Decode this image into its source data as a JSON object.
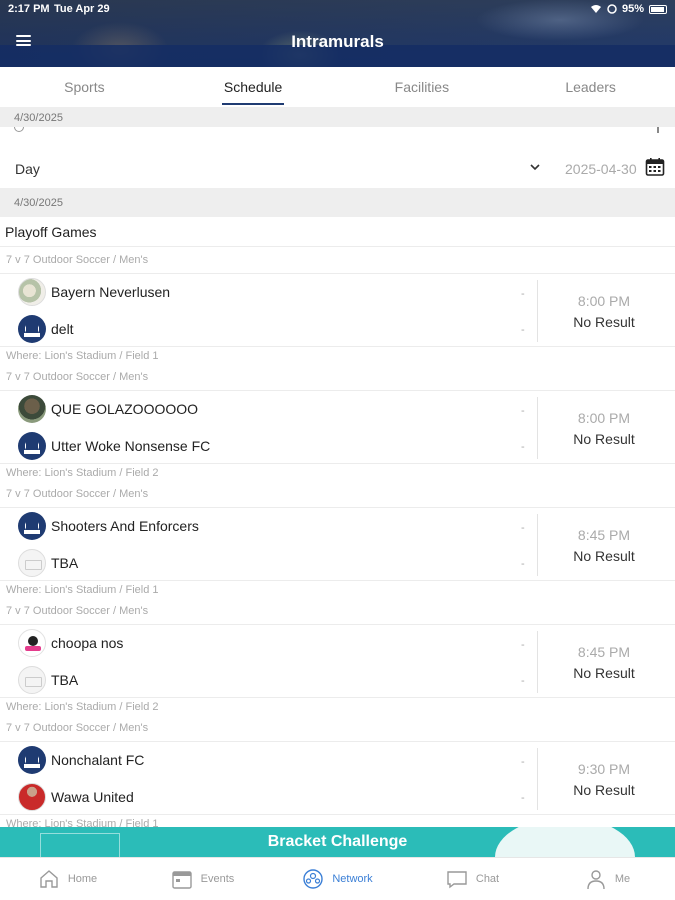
{
  "status_bar": {
    "time": "2:17 PM",
    "date": "Tue Apr 29",
    "battery": "95%"
  },
  "app": {
    "title": "Intramurals"
  },
  "tabs": [
    {
      "label": "Sports",
      "active": false
    },
    {
      "label": "Schedule",
      "active": true
    },
    {
      "label": "Facilities",
      "active": false
    },
    {
      "label": "Leaders",
      "active": false
    }
  ],
  "top_band_date": "4/30/2025",
  "filter": {
    "view": "Day",
    "date": "2025-04-30"
  },
  "schedule_date": "4/30/2025",
  "group_title": "Playoff Games",
  "games": [
    {
      "sport": "7 v 7 Outdoor Soccer / Men's",
      "team1": {
        "name": "Bayern Neverlusen",
        "score": "-"
      },
      "team2": {
        "name": "delt",
        "score": "-"
      },
      "time": "8:00 PM",
      "result": "No Result",
      "where": "Where: Lion's Stadium / Field 1"
    },
    {
      "sport": "7 v 7 Outdoor Soccer / Men's",
      "team1": {
        "name": "QUE GOLAZOOOOOO",
        "score": "-"
      },
      "team2": {
        "name": "Utter Woke Nonsense FC",
        "score": "-"
      },
      "time": "8:00 PM",
      "result": "No Result",
      "where": "Where: Lion's Stadium / Field 2"
    },
    {
      "sport": "7 v 7 Outdoor Soccer / Men's",
      "team1": {
        "name": "Shooters And Enforcers",
        "score": "-"
      },
      "team2": {
        "name": "TBA",
        "score": "-"
      },
      "time": "8:45 PM",
      "result": "No Result",
      "where": "Where: Lion's Stadium / Field 1"
    },
    {
      "sport": "7 v 7 Outdoor Soccer / Men's",
      "team1": {
        "name": "choopa nos",
        "score": "-"
      },
      "team2": {
        "name": "TBA",
        "score": "-"
      },
      "time": "8:45 PM",
      "result": "No Result",
      "where": "Where: Lion's Stadium / Field 2"
    },
    {
      "sport": "7 v 7 Outdoor Soccer / Men's",
      "team1": {
        "name": "Nonchalant FC",
        "score": "-"
      },
      "team2": {
        "name": "Wawa United",
        "score": "-"
      },
      "time": "9:30 PM",
      "result": "No Result",
      "where": "Where: Lion's Stadium / Field 1"
    }
  ],
  "banner": {
    "label": "Bracket Challenge"
  },
  "bottom_nav": [
    {
      "label": "Home",
      "icon": "home-icon"
    },
    {
      "label": "Events",
      "icon": "calendar-icon"
    },
    {
      "label": "Network",
      "icon": "network-icon",
      "active": true
    },
    {
      "label": "Chat",
      "icon": "chat-icon"
    },
    {
      "label": "Me",
      "icon": "person-icon"
    }
  ],
  "colors": {
    "brand_navy": "#1f3b72",
    "banner_teal": "#2bbcb8",
    "active_nav": "#3b7fd6"
  }
}
